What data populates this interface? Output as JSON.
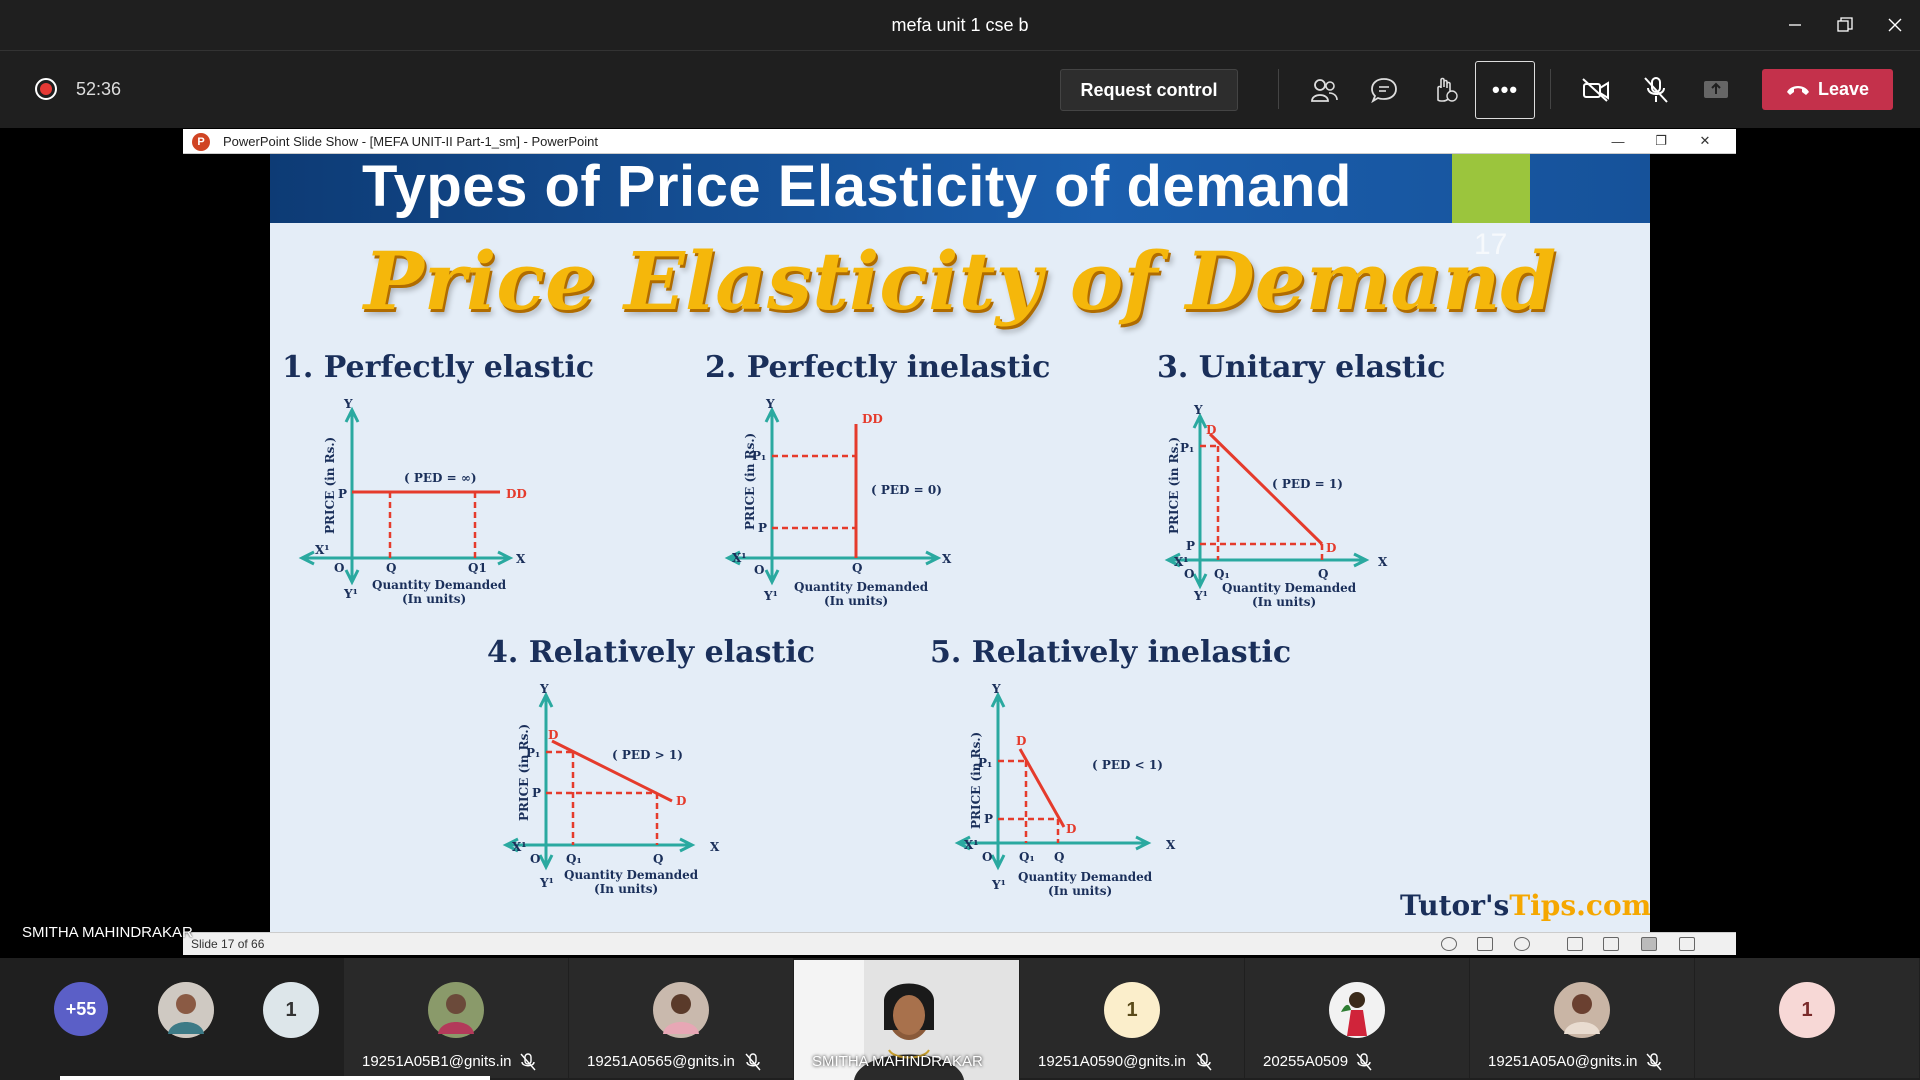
{
  "window": {
    "title": "mefa unit 1 cse b"
  },
  "toolbar": {
    "timer": "52:36",
    "request_control": "Request control",
    "more": "•••",
    "leave": "Leave"
  },
  "ppt": {
    "title": "PowerPoint Slide Show - [MEFA UNIT-II Part-1_sm] - PowerPoint",
    "status": "Slide 17 of 66"
  },
  "slide": {
    "header": "Types of Price Elasticity of demand",
    "slide_number": "17",
    "big_title": "Price Elasticity of Demand",
    "watermark_a": "Tutor's",
    "watermark_b": "Tips.com",
    "sections": [
      {
        "title": "1. Perfectly elastic",
        "ped": "( PED = ∞)"
      },
      {
        "title": "2. Perfectly inelastic",
        "ped": "( PED = 0)"
      },
      {
        "title": "3. Unitary elastic",
        "ped": "( PED = 1)"
      },
      {
        "title": "4. Relatively elastic",
        "ped": "( PED > 1)"
      },
      {
        "title": "5. Relatively inelastic",
        "ped": "( PED < 1)"
      }
    ],
    "axis": {
      "ylabel": "PRICE (in Rs.)",
      "xlabel_1": "Quantity Demanded",
      "xlabel_2": "(In units)",
      "x": "X",
      "x_neg": "X¹",
      "y": "Y",
      "y_neg": "Y¹",
      "o": "O",
      "p": "P",
      "p1": "P₁",
      "q": "Q",
      "q1": "Q₁",
      "q1_plain": "Q1",
      "d": "D",
      "dd": "DD"
    }
  },
  "presenter": "SMITHA MAHINDRAKAR",
  "participants": {
    "overflow": "+55",
    "count_a": "1",
    "p1": "19251A05B1@gnits.in",
    "p2": "19251A0565@gnits.in",
    "p3": "SMITHA MAHINDRAKAR",
    "p4_count": "1",
    "p4": "19251A0590@gnits.in",
    "p5": "20255A0509",
    "p6": "19251A05A0@gnits.in",
    "count_b": "1"
  },
  "colors": {
    "leave": "#c4314b",
    "axis": "#2aa9a0",
    "curve": "#e53b2c",
    "title_gold": "#f5b70b",
    "header_blue": "#1b5fae"
  }
}
